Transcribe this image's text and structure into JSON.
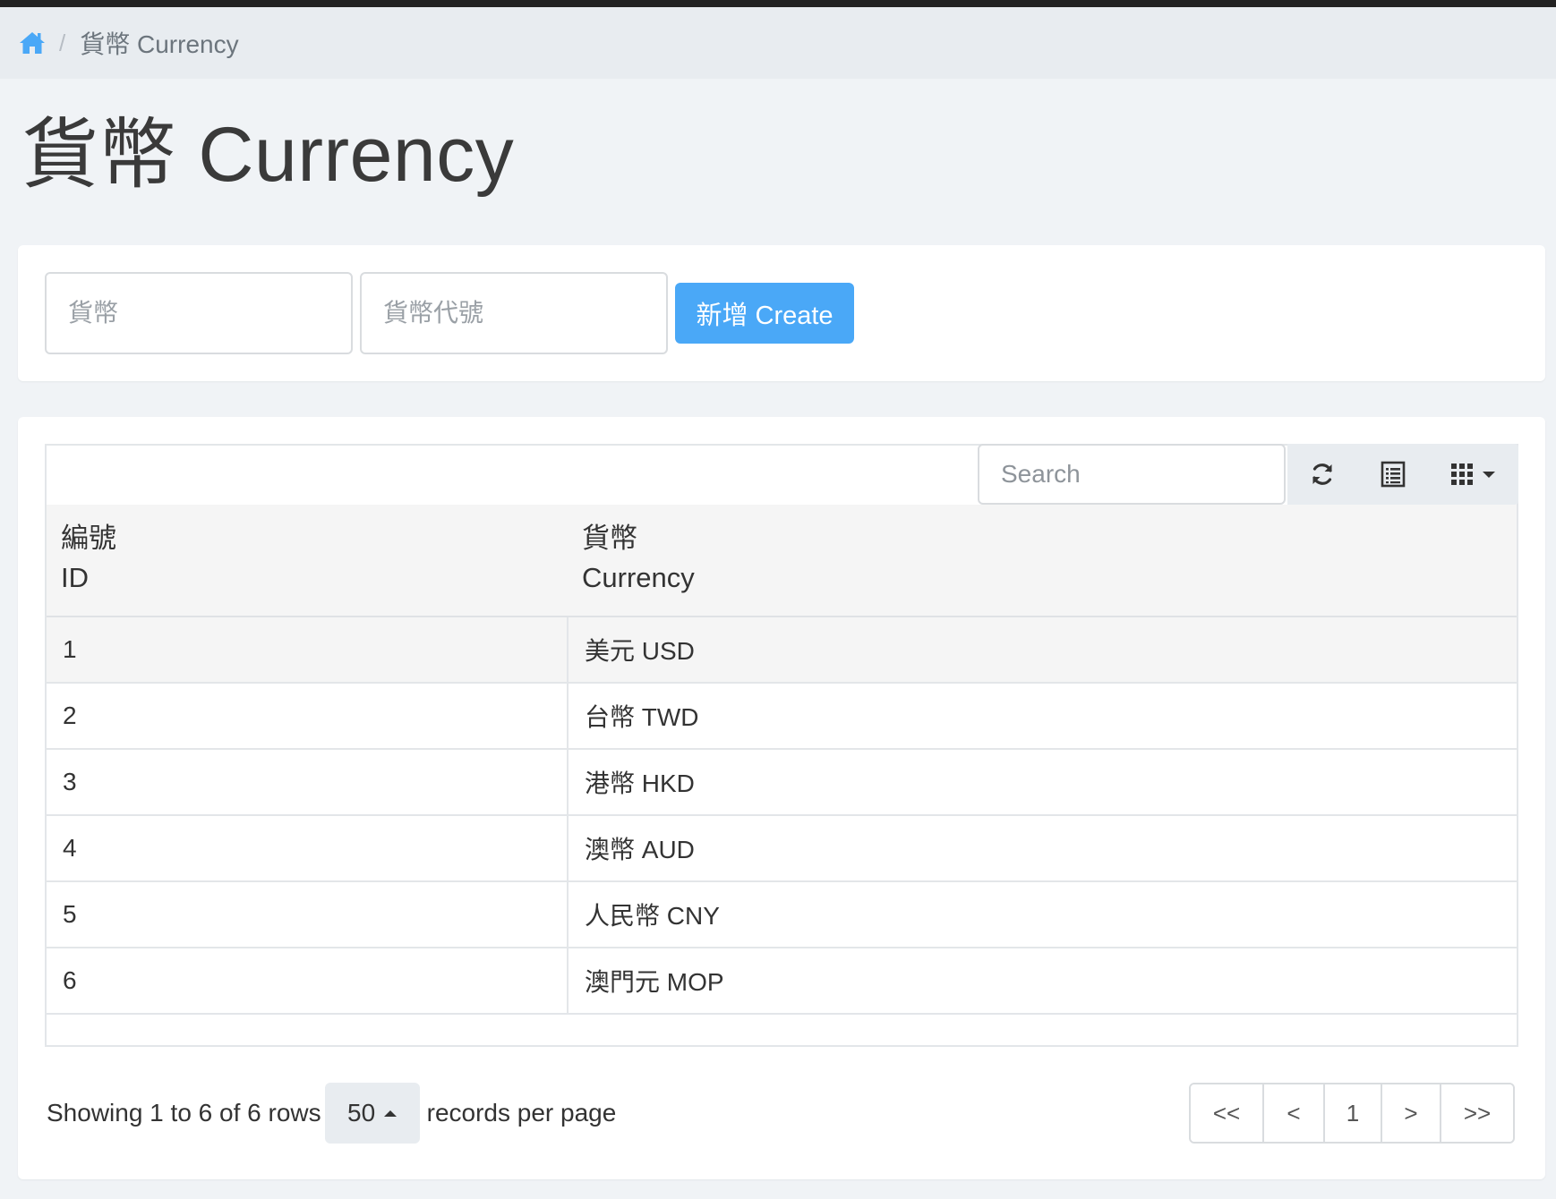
{
  "breadcrumb": {
    "home_icon": "home-icon",
    "separator": "/",
    "current": "貨幣 Currency"
  },
  "page": {
    "title": "貨幣 Currency"
  },
  "form": {
    "currency_placeholder": "貨幣",
    "code_placeholder": "貨幣代號",
    "create_label": "新增 Create"
  },
  "toolbar": {
    "search_placeholder": "Search",
    "icons": [
      "refresh-icon",
      "list-view-icon",
      "columns-icon",
      "caret-down-icon"
    ]
  },
  "table": {
    "headers": [
      {
        "line1": "編號",
        "line2": "ID"
      },
      {
        "line1": "貨幣",
        "line2": "Currency"
      }
    ],
    "rows": [
      {
        "id": "1",
        "currency": "美元 USD"
      },
      {
        "id": "2",
        "currency": "台幣 TWD"
      },
      {
        "id": "3",
        "currency": "港幣 HKD"
      },
      {
        "id": "4",
        "currency": "澳幣 AUD"
      },
      {
        "id": "5",
        "currency": "人民幣 CNY"
      },
      {
        "id": "6",
        "currency": "澳門元 MOP"
      }
    ]
  },
  "footer": {
    "showing": "Showing 1 to 6 of 6 rows",
    "page_size": "50",
    "per_page_label": "records per page"
  },
  "pagination": {
    "first": "<<",
    "prev": "<",
    "current": "1",
    "next": ">",
    "last": ">>"
  },
  "colors": {
    "accent": "#4aa8f7",
    "toolbar_bg": "#e8ecf0",
    "page_bg": "#f0f3f6"
  }
}
